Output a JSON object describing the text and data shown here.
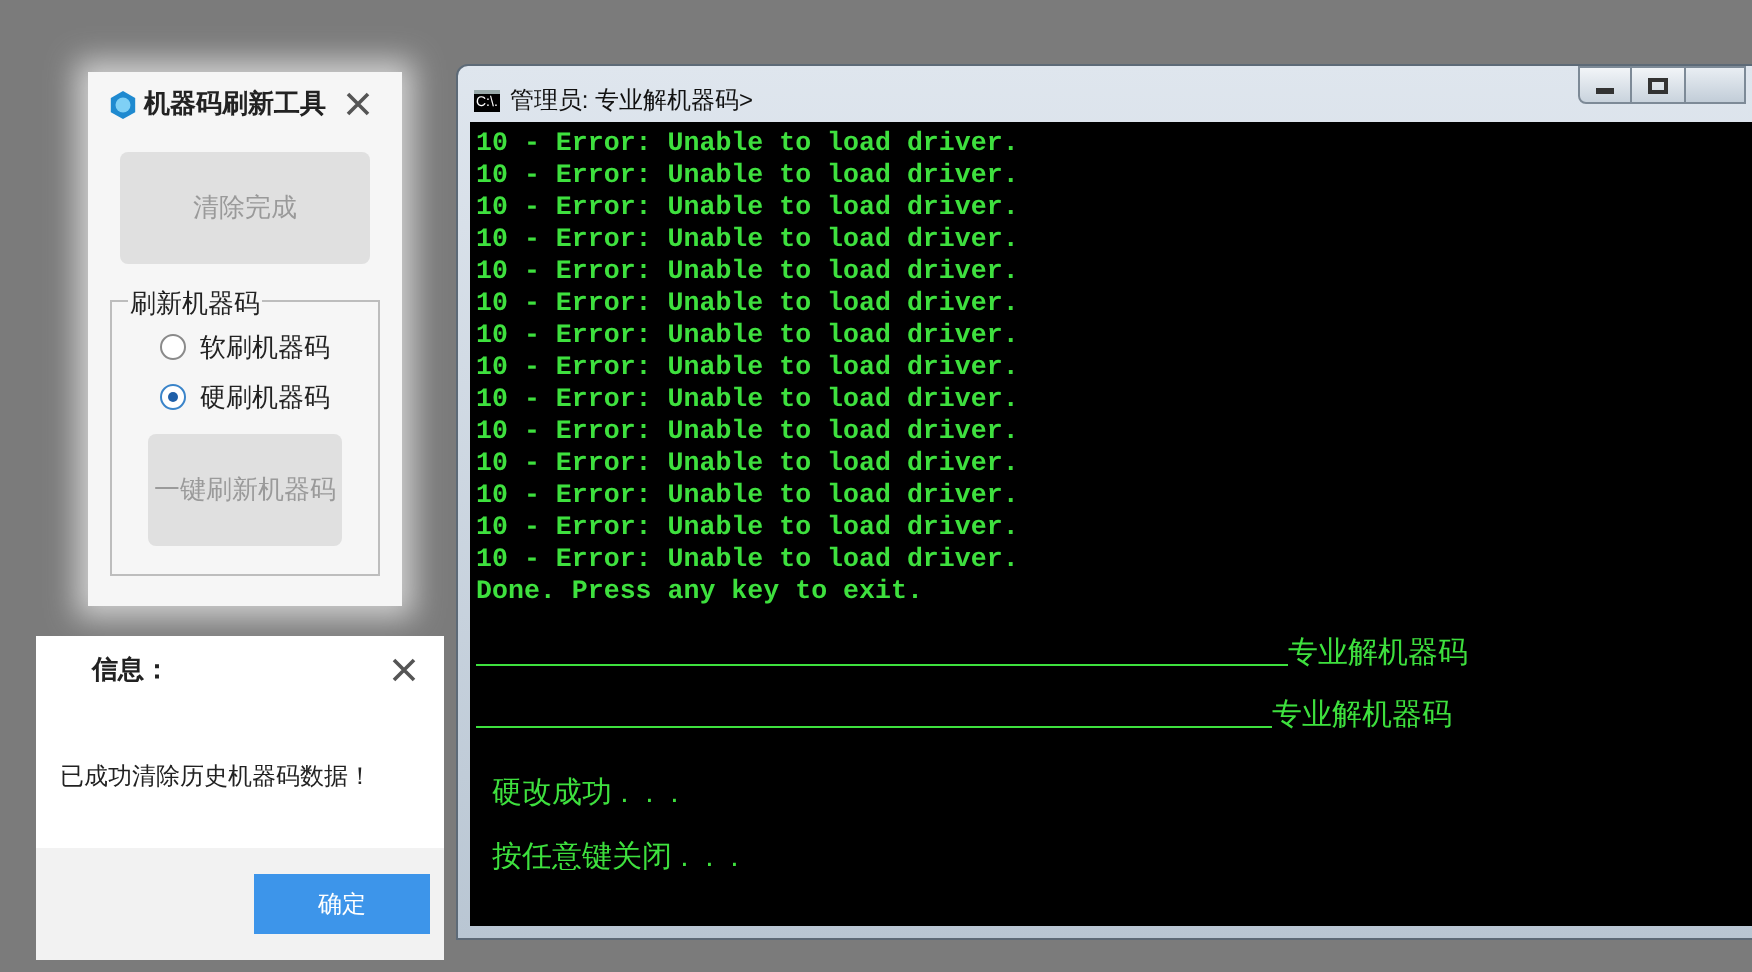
{
  "tool_window": {
    "title": "机器码刷新工具",
    "clear_button": "清除完成",
    "group": {
      "legend": "刷新机器码",
      "options": [
        {
          "label": "软刷机器码",
          "selected": false
        },
        {
          "label": "硬刷机器码",
          "selected": true
        }
      ],
      "refresh_button": "一键刷新机器码"
    }
  },
  "info_dialog": {
    "title": "信息：",
    "message": "已成功清除历史机器码数据！",
    "ok_button": "确定"
  },
  "console": {
    "title": "管理员: 专业解机器码>",
    "icon_text": "C:\\.",
    "lines": [
      "10 - Error: Unable to load driver.",
      "10 - Error: Unable to load driver.",
      "10 - Error: Unable to load driver.",
      "10 - Error: Unable to load driver.",
      "10 - Error: Unable to load driver.",
      "10 - Error: Unable to load driver.",
      "10 - Error: Unable to load driver.",
      "10 - Error: Unable to load driver.",
      "10 - Error: Unable to load driver.",
      "10 - Error: Unable to load driver.",
      "10 - Error: Unable to load driver.",
      "10 - Error: Unable to load driver.",
      "10 - Error: Unable to load driver.",
      "10 - Error: Unable to load driver.",
      "Done. Press any key to exit."
    ],
    "banners": [
      "专业解机器码",
      "专业解机器码"
    ],
    "messages": [
      "硬改成功 .  .  .",
      "按任意键关闭 .  .  ."
    ]
  }
}
